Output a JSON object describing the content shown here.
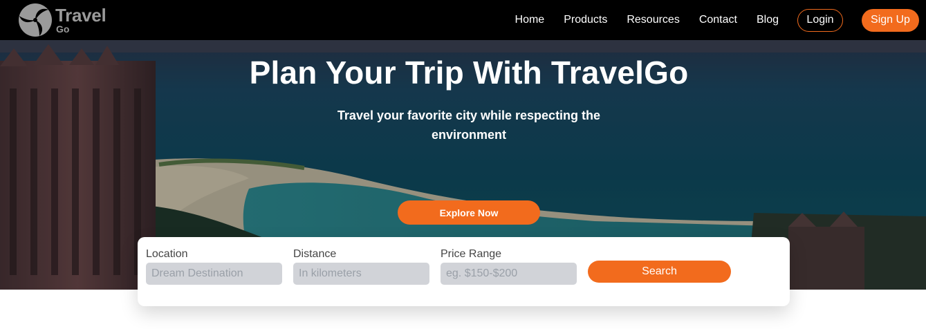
{
  "brand": {
    "name": "Travel",
    "sub": "Go",
    "logo_icon": "swirl-logo-icon",
    "logo_color": "#9a9a9a"
  },
  "nav": {
    "links": [
      "Home",
      "Products",
      "Resources",
      "Contact",
      "Blog"
    ],
    "login_label": "Login",
    "signup_label": "Sign Up"
  },
  "hero": {
    "title": "Plan Your Trip With TravelGo",
    "subtitle": "Travel your favorite city while respecting the environment",
    "cta_label": "Explore Now"
  },
  "search": {
    "location": {
      "label": "Location",
      "placeholder": "Dream Destination"
    },
    "distance": {
      "label": "Distance",
      "placeholder": "In kilometers"
    },
    "price": {
      "label": "Price Range",
      "placeholder": "eg. $150-$200"
    },
    "button_label": "Search"
  },
  "colors": {
    "accent": "#f26b1d",
    "nav_bg": "#000000",
    "input_bg": "#d1d3d8"
  }
}
